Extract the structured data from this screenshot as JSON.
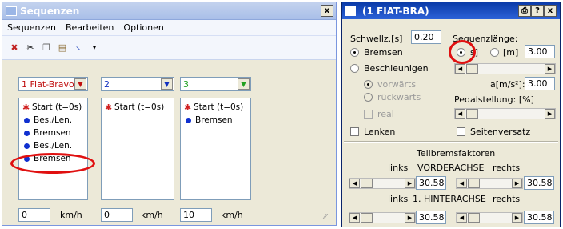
{
  "seq_window": {
    "title": "Sequenzen",
    "close": "x",
    "menu": [
      "Sequenzen",
      "Bearbeiten",
      "Optionen"
    ],
    "toolbar_icons": [
      "delete-icon",
      "cut-icon",
      "copy-icon",
      "paste-icon",
      "chart-icon",
      "dropdown-arrow-icon"
    ],
    "columns": [
      {
        "label": "1  Fiat-Bravo",
        "color": "#c01010",
        "items": [
          {
            "type": "star",
            "text": "Start (t=0s)"
          },
          {
            "type": "dot",
            "text": "Bes./Len."
          },
          {
            "type": "dot",
            "text": "Bremsen"
          },
          {
            "type": "dot",
            "text": "Bes./Len."
          },
          {
            "type": "dot",
            "text": "Bremsen"
          }
        ],
        "speed": "0",
        "unit": "km/h"
      },
      {
        "label": "2",
        "color": "#1030c0",
        "items": [
          {
            "type": "star",
            "text": "Start (t=0s)"
          }
        ],
        "speed": "0",
        "unit": "km/h"
      },
      {
        "label": "3",
        "color": "#20a020",
        "items": [
          {
            "type": "star",
            "text": "Start (t=0s)"
          },
          {
            "type": "dot",
            "text": "Bremsen"
          }
        ],
        "speed": "10",
        "unit": "km/h"
      }
    ]
  },
  "fiat_window": {
    "title": "(1  FIAT-BRA)",
    "title_buttons": [
      "⎙",
      "?",
      "x"
    ],
    "schwellz_label": "Schwellz.[s]",
    "schwellz_value": "0.20",
    "seqlaenge_label": "Sequenzlänge:",
    "opt_bremsen": "Bremsen",
    "opt_beschleunigen": "Beschleunigen",
    "opt_s": "s]",
    "opt_m": "[m]",
    "seq_value": "3.00",
    "vorwaerts": "vorwärts",
    "rueckwaerts": "rückwärts",
    "real": "real",
    "a_label": "a[m/s²]:",
    "a_value": "3.00",
    "pedal_label": "Pedalstellung: [%]",
    "lenken": "Lenken",
    "seitenversatz": "Seitenversatz",
    "teilbrems": "Teilbremsfaktoren",
    "links1": "links",
    "vorder": "VORDERACHSE",
    "rechts1": "rechts",
    "links2": "links",
    "hinter": "1. HINTERACHSE",
    "rechts2": "rechts",
    "v_left": "30.58",
    "v_right": "30.58",
    "h_left": "30.58",
    "h_right": "30.58"
  }
}
